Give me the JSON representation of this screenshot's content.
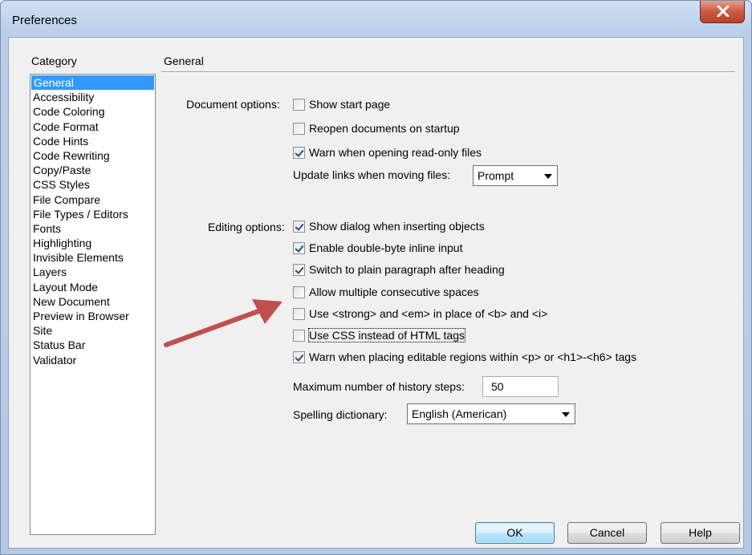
{
  "window": {
    "title": "Preferences",
    "close_icon": "close-icon"
  },
  "category": {
    "label": "Category",
    "items": [
      "General",
      "Accessibility",
      "Code Coloring",
      "Code Format",
      "Code Hints",
      "Code Rewriting",
      "Copy/Paste",
      "CSS Styles",
      "File Compare",
      "File Types / Editors",
      "Fonts",
      "Highlighting",
      "Invisible Elements",
      "Layers",
      "Layout Mode",
      "New Document",
      "Preview in Browser",
      "Site",
      "Status Bar",
      "Validator"
    ],
    "selected": "General"
  },
  "section": {
    "title": "General"
  },
  "document_options": {
    "label": "Document options:",
    "show_start_page": {
      "label": "Show start page",
      "checked": false
    },
    "reopen_documents": {
      "label": "Reopen documents on startup",
      "checked": false
    },
    "warn_readonly": {
      "label": "Warn when opening read-only files",
      "checked": true
    },
    "update_links_label": "Update links when moving files:",
    "update_links_value": "Prompt"
  },
  "editing_options": {
    "label": "Editing options:",
    "items": [
      {
        "label": "Show dialog when inserting objects",
        "checked": true
      },
      {
        "label": "Enable double-byte inline input",
        "checked": true
      },
      {
        "label": "Switch to plain paragraph after heading",
        "checked": true
      },
      {
        "label": "Allow multiple consecutive spaces",
        "checked": false
      },
      {
        "label": "Use <strong> and <em> in place of <b> and <i>",
        "checked": false
      },
      {
        "label": "Use CSS instead of HTML tags",
        "checked": false
      },
      {
        "label": "Warn when placing editable regions within <p> or <h1>-<h6> tags",
        "checked": true
      }
    ],
    "history_label": "Maximum number of history steps:",
    "history_value": "50",
    "spelling_label": "Spelling dictionary:",
    "spelling_value": "English (American)"
  },
  "buttons": {
    "ok": "OK",
    "cancel": "Cancel",
    "help": "Help"
  },
  "annotation": {
    "arrow_color": "#c0504d"
  }
}
